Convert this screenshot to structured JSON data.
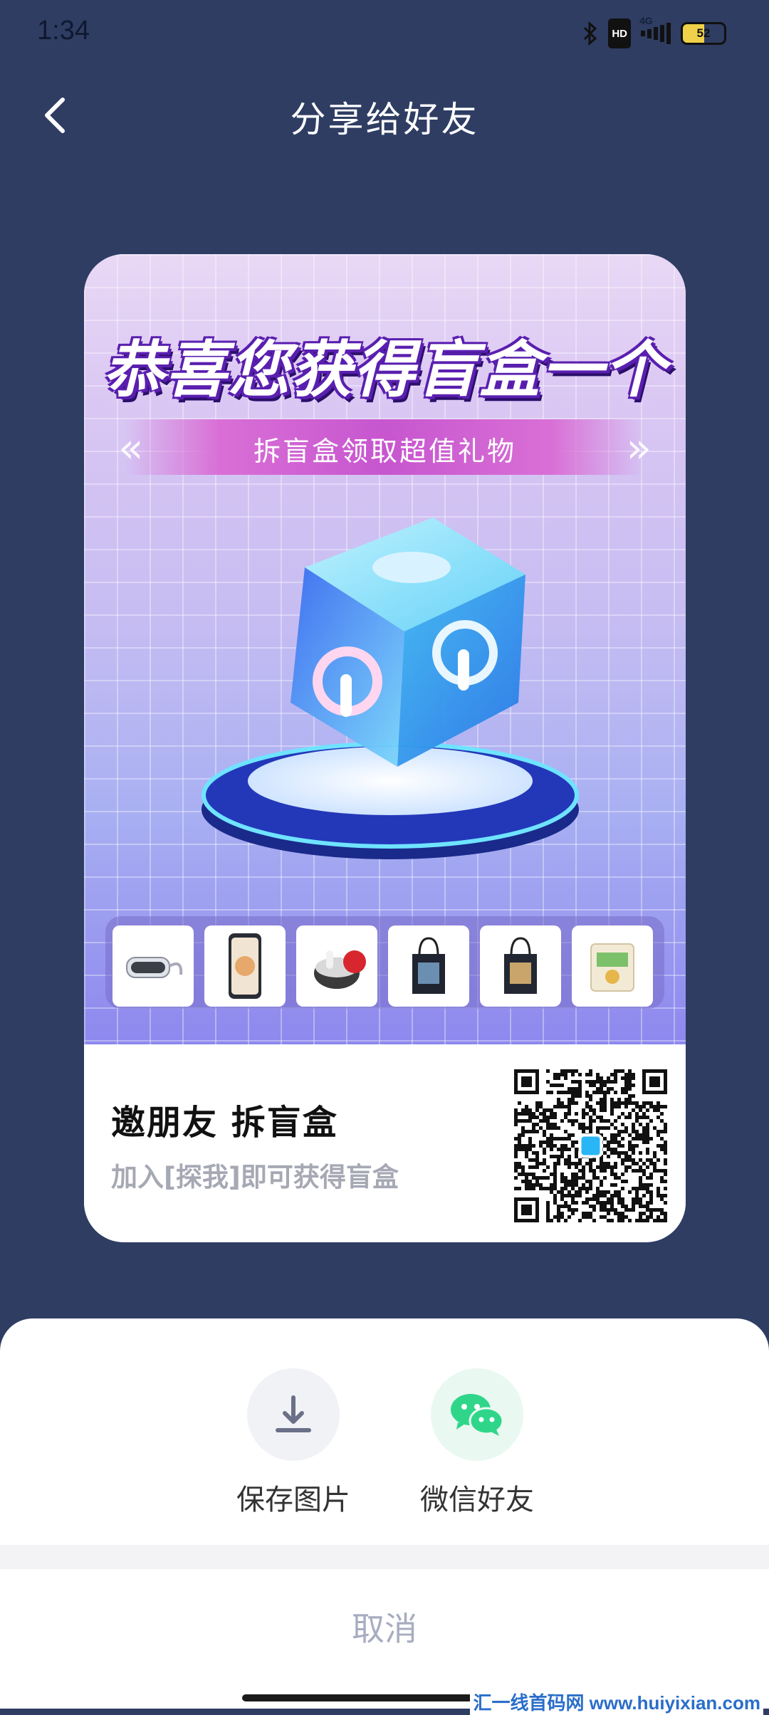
{
  "status_bar": {
    "time": "1:34",
    "network": "4G",
    "hd": "HD",
    "battery": "52",
    "battery_level": 0.52,
    "icons": [
      "bluetooth-icon",
      "hd-icon",
      "signal-icon",
      "battery-icon"
    ]
  },
  "header": {
    "title": "分享给好友",
    "back_icon": "chevron-left-icon"
  },
  "poster": {
    "headline": "恭喜您获得盲盒一个",
    "ribbon_text": "拆盲盒领取超值礼物",
    "products": [
      "vr-headset",
      "smartphone",
      "earbuds",
      "tote-bag",
      "tote-bag",
      "tissue-pack"
    ],
    "invite_title": "邀朋友 拆盲盒",
    "invite_subtitle": "加入[探我]即可获得盲盒",
    "qr_icon": "qr-code"
  },
  "share_sheet": {
    "options": [
      {
        "label": "保存图片",
        "icon": "download-icon"
      },
      {
        "label": "微信好友",
        "icon": "wechat-icon"
      }
    ],
    "cancel_label": "取消"
  },
  "watermark": "汇一线首码网 www.huiyixian.com",
  "colors": {
    "page_bg": "#2f3d63",
    "ribbon": "#c756cf",
    "wechat_green": "#2fd68a",
    "wechat_circle_bg": "#e9f8f1",
    "save_circle_bg": "#f1f2f5"
  }
}
